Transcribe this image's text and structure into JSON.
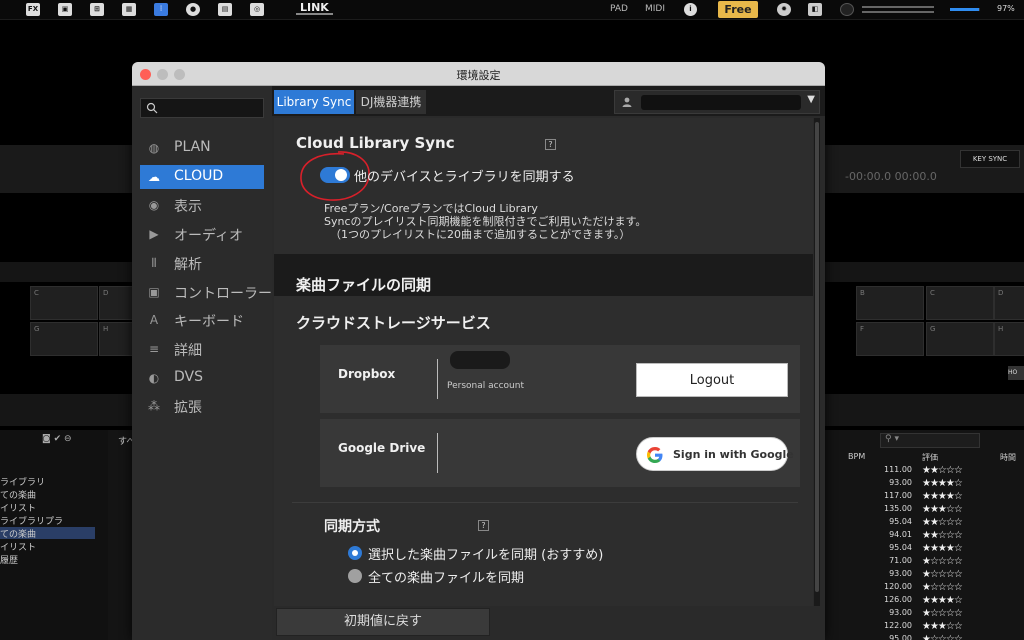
{
  "toolbar": {
    "fx_label": "FX",
    "link_label": "LINK",
    "pad_label": "PAD",
    "midi_label": "MIDI",
    "free_label": "Free",
    "battery_pct": "97%",
    "battery_level": 0.97
  },
  "background": {
    "key_sync": "KEY SYNC",
    "time_readout": "-00:00.0  00:00.0",
    "hot_cue_label": "HO",
    "pad_letters_left": [
      "C",
      "D",
      "G",
      "H"
    ],
    "pad_letters_right": [
      "B",
      "C",
      "D",
      "F",
      "G",
      "H"
    ],
    "tree": [
      "ライブラリ",
      "ての楽曲",
      "イリスト",
      "ライブラリプラ",
      "ての楽曲",
      "イリスト",
      "履歴"
    ],
    "list_tab": "すべ",
    "headers": {
      "bpm": "BPM",
      "rating": "評価",
      "time": "時間"
    },
    "tracks": [
      {
        "bpm": "111.00",
        "stars": "★★☆☆☆"
      },
      {
        "bpm": "93.00",
        "stars": "★★★★☆"
      },
      {
        "bpm": "117.00",
        "stars": "★★★★☆"
      },
      {
        "bpm": "135.00",
        "stars": "★★★☆☆"
      },
      {
        "bpm": "95.04",
        "stars": "★★☆☆☆"
      },
      {
        "bpm": "94.01",
        "stars": "★★☆☆☆"
      },
      {
        "bpm": "95.04",
        "stars": "★★★★☆"
      },
      {
        "bpm": "71.00",
        "stars": "★☆☆☆☆"
      },
      {
        "bpm": "93.00",
        "stars": "★☆☆☆☆"
      },
      {
        "bpm": "120.00",
        "stars": "★☆☆☆☆"
      },
      {
        "bpm": "126.00",
        "stars": "★★★★☆"
      },
      {
        "bpm": "93.00",
        "stars": "★☆☆☆☆"
      },
      {
        "bpm": "122.00",
        "stars": "★★★☆☆"
      },
      {
        "bpm": "95.00",
        "stars": "★☆☆☆☆"
      }
    ]
  },
  "dialog": {
    "title": "環境設定",
    "sidebar": [
      {
        "label": "PLAN",
        "icon": "globe-icon",
        "glyph": "◍"
      },
      {
        "label": "CLOUD",
        "icon": "cloud-sync-icon",
        "glyph": "☁"
      },
      {
        "label": "表示",
        "icon": "eye-icon",
        "glyph": "◉"
      },
      {
        "label": "オーディオ",
        "icon": "speaker-icon",
        "glyph": "▶"
      },
      {
        "label": "解析",
        "icon": "waveform-icon",
        "glyph": "⦀"
      },
      {
        "label": "コントローラー",
        "icon": "controller-icon",
        "glyph": "▣"
      },
      {
        "label": "キーボード",
        "icon": "keyboard-icon",
        "glyph": "A"
      },
      {
        "label": "詳細",
        "icon": "list-icon",
        "glyph": "≡"
      },
      {
        "label": "DVS",
        "icon": "vinyl-icon",
        "glyph": "◐"
      },
      {
        "label": "拡張",
        "icon": "extension-icon",
        "glyph": "⁂"
      }
    ],
    "tabs": {
      "sync": "Library Sync",
      "device": "DJ機器連携"
    },
    "cloud_sync": {
      "heading": "Cloud Library Sync",
      "toggle_label": "他のデバイスとライブラリを同期する",
      "toggle_on": true,
      "note_line1": "Freeプラン/CoreプランではCloud Library",
      "note_line2": "Syncのプレイリスト同期機能を制限付きでご利用いただけます。",
      "note_line3": "（1つのプレイリストに20曲まで追加することができます。）"
    },
    "file_sync_heading": "楽曲ファイルの同期",
    "storage": {
      "heading": "クラウドストレージサービス",
      "dropbox_name": "Dropbox",
      "dropbox_account": "Personal account",
      "logout_label": "Logout",
      "gdrive_name": "Google Drive",
      "google_signin": "Sign in with Google"
    },
    "sync_method": {
      "heading": "同期方式",
      "option1": "選択した楽曲ファイルを同期 (おすすめ)",
      "option2": "全ての楽曲ファイルを同期",
      "selected": 1
    },
    "reset_label": "初期値に戻す"
  },
  "colors": {
    "accent": "#2e7ad6",
    "free_badge": "#e8b84a",
    "annotation": "#d8202a"
  }
}
